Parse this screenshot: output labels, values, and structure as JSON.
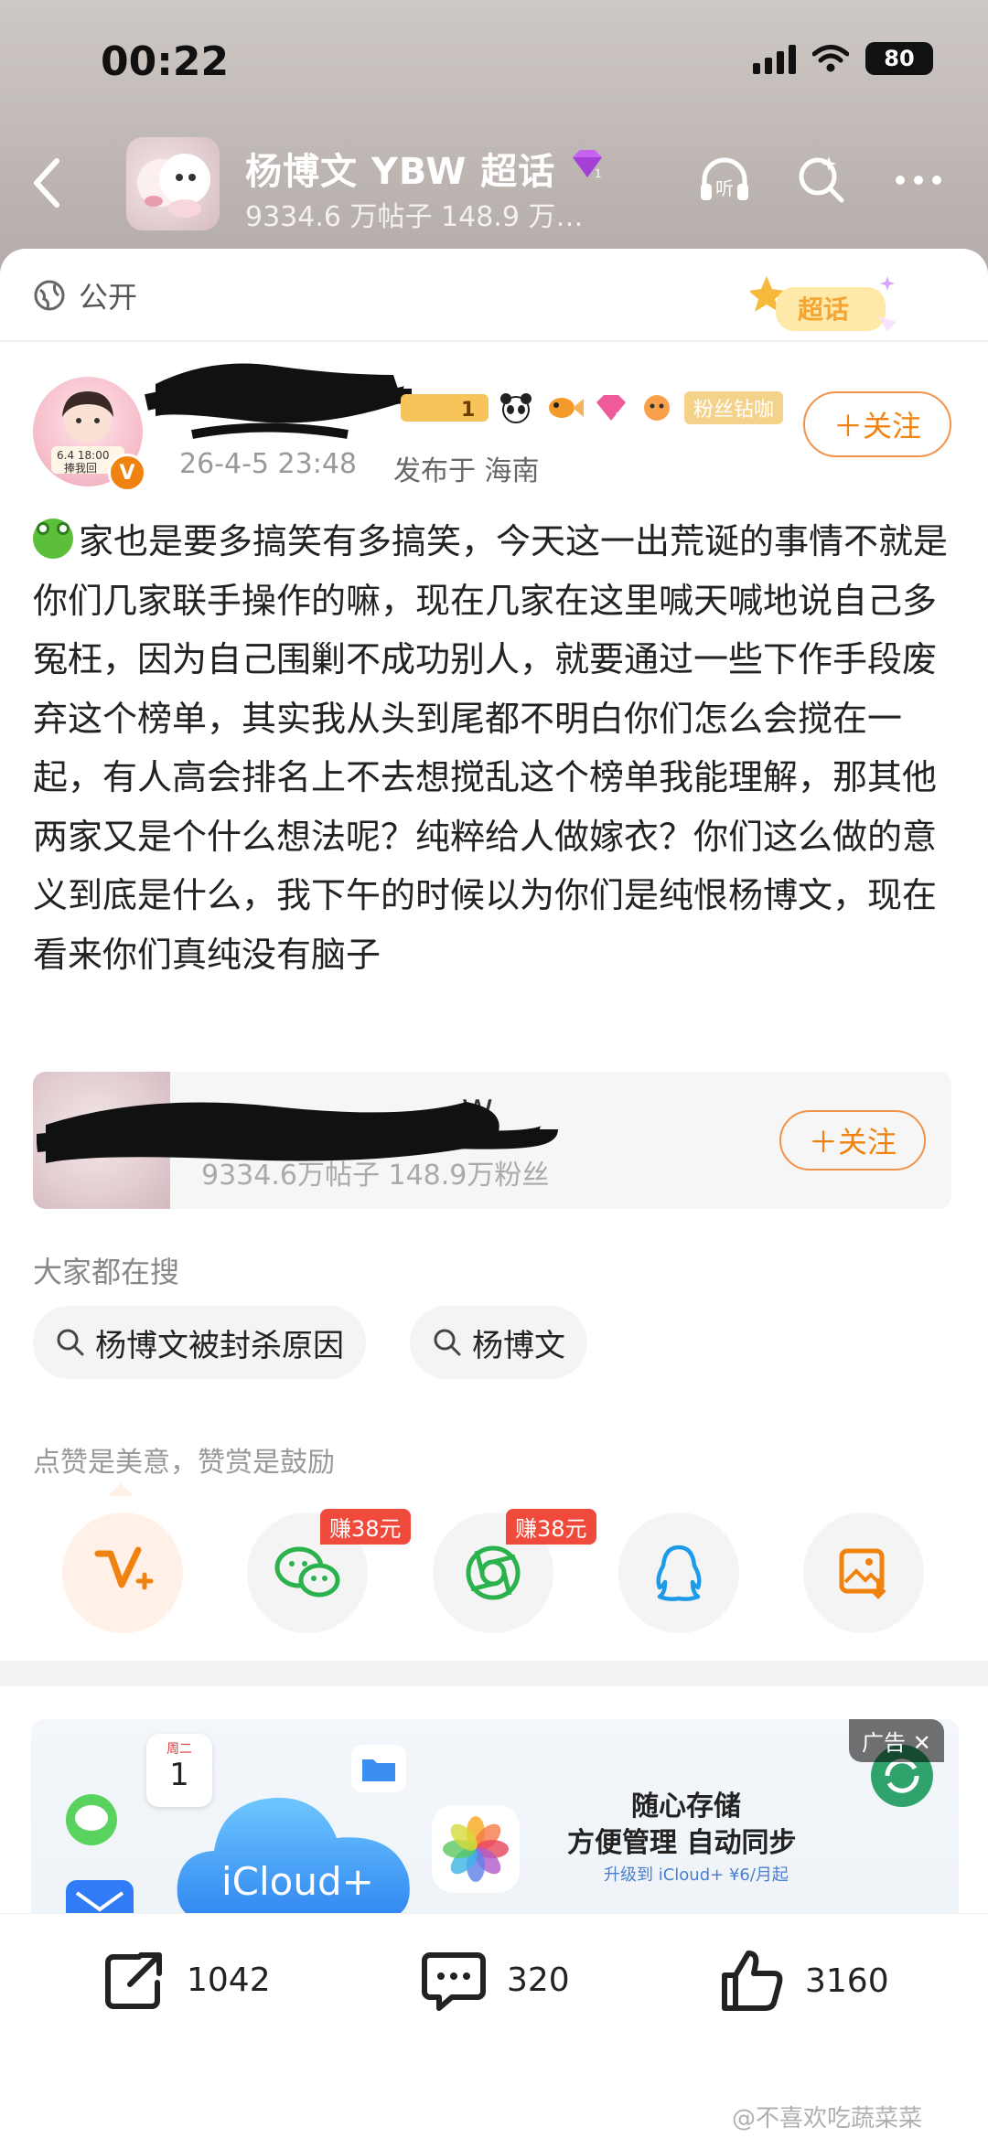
{
  "status_bar": {
    "time": "00:22",
    "battery": "80"
  },
  "header": {
    "title": "杨博文 YBW 超话",
    "subtitle": "9334.6 万帖子 148.9 万…",
    "listen_label": "听"
  },
  "visibility": "公开",
  "supertopic_badge": "超话",
  "post": {
    "level_label": "1",
    "fan_badge": "粉丝钻咖",
    "time": "26-4-5 23:48",
    "location": "发布于 海南",
    "follow_label": "＋关注",
    "avatar_text": "6.4 18:00",
    "avatar_sub": "捧我回",
    "body": "家也是要多搞笑有多搞笑，今天这一出荒诞的事情不就是你们几家联手操作的嘛，现在几家在这里喊天喊地说自己多冤枉，因为自己围剿不成功别人，就要通过一些下作手段废弃这个榜单，其实我从头到尾都不明白你们怎么会搅在一起，有人高会排名上不去想搅乱这个榜单我能理解，那其他两家又是个什么想法呢？纯粹给人做嫁衣？你们这么做的意义到底是什么，我下午的时候以为你们是纯恨杨博文，现在看来你们真纯没有脑子"
  },
  "topic_card": {
    "title_tail": "W",
    "subtitle": "9334.6万帖子  148.9万粉丝",
    "follow_label": "＋关注"
  },
  "search": {
    "heading": "大家都在搜",
    "chips": [
      "杨博文被封杀原因",
      "杨博文"
    ]
  },
  "reward_line": "点赞是美意，赞赏是鼓励",
  "share_targets": [
    {
      "icon": "weibo-reward-icon",
      "tag": ""
    },
    {
      "icon": "wechat-icon",
      "tag": "赚38元"
    },
    {
      "icon": "moments-icon",
      "tag": "赚38元"
    },
    {
      "icon": "qq-icon",
      "tag": ""
    },
    {
      "icon": "save-image-icon",
      "tag": ""
    }
  ],
  "ad": {
    "tag": "广告",
    "headline": "随心存储",
    "tagline": "方便管理 自动同步",
    "small": "升级到 iCloud+ ¥6/月起",
    "brand": "iCloud+",
    "calendar_day": "周二",
    "calendar_num": "1"
  },
  "actions": {
    "repost": "1042",
    "comments": "320",
    "likes": "3160"
  },
  "watermark": "@不喜欢吃蔬菜菜",
  "colors": {
    "accent": "#f0820f",
    "earn_red": "#f04a3c",
    "wechat_green": "#2bb24c",
    "qq_blue": "#1e9be8"
  }
}
